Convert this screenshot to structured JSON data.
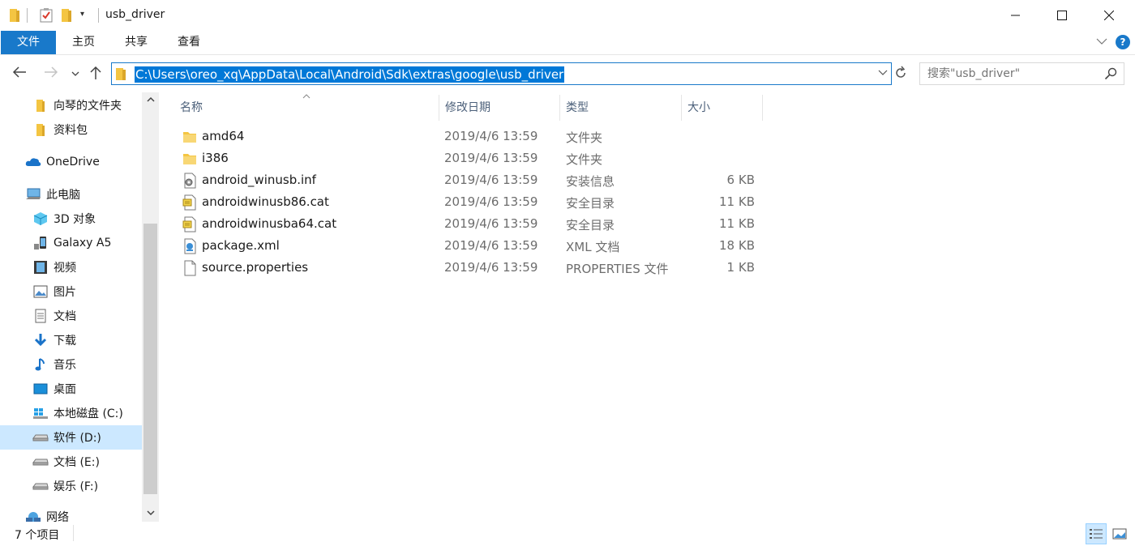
{
  "window": {
    "title": "usb_driver",
    "controls": {
      "minimize": "—",
      "maximize": "☐",
      "close": "✕"
    }
  },
  "ribbon": {
    "tabs": [
      {
        "label": "文件",
        "active": true
      },
      {
        "label": "主页"
      },
      {
        "label": "共享"
      },
      {
        "label": "查看"
      }
    ],
    "help_label": "?"
  },
  "nav": {
    "address": "C:\\Users\\oreo_xq\\AppData\\Local\\Android\\Sdk\\extras\\google\\usb_driver",
    "search_placeholder": "搜索\"usb_driver\""
  },
  "sidebar": {
    "items": [
      {
        "label": "向琴的文件夹",
        "icon": "folder-icon"
      },
      {
        "label": "资料包",
        "icon": "folder-icon"
      },
      {
        "label": "OneDrive",
        "icon": "onedrive-icon"
      },
      {
        "label": "此电脑",
        "icon": "this-pc-icon"
      },
      {
        "label": "3D 对象",
        "icon": "3d-objects-icon"
      },
      {
        "label": "Galaxy A5",
        "icon": "phone-icon"
      },
      {
        "label": "视频",
        "icon": "video-icon"
      },
      {
        "label": "图片",
        "icon": "pictures-icon"
      },
      {
        "label": "文档",
        "icon": "documents-icon"
      },
      {
        "label": "下载",
        "icon": "download-icon"
      },
      {
        "label": "音乐",
        "icon": "music-icon"
      },
      {
        "label": "桌面",
        "icon": "desktop-icon"
      },
      {
        "label": "本地磁盘 (C:)",
        "icon": "windows-drive-icon"
      },
      {
        "label": "软件 (D:)",
        "icon": "drive-icon",
        "selected": true
      },
      {
        "label": "文档 (E:)",
        "icon": "drive-icon"
      },
      {
        "label": "娱乐 (F:)",
        "icon": "drive-icon"
      },
      {
        "label": "网络",
        "icon": "network-icon"
      }
    ]
  },
  "columns": {
    "name": "名称",
    "date": "修改日期",
    "type": "类型",
    "size": "大小"
  },
  "files": [
    {
      "name": "amd64",
      "date": "2019/4/6 13:59",
      "type": "文件夹",
      "size": "",
      "icon": "folder-icon"
    },
    {
      "name": "i386",
      "date": "2019/4/6 13:59",
      "type": "文件夹",
      "size": "",
      "icon": "folder-icon"
    },
    {
      "name": "android_winusb.inf",
      "date": "2019/4/6 13:59",
      "type": "安装信息",
      "size": "6 KB",
      "icon": "setup-info-icon"
    },
    {
      "name": "androidwinusb86.cat",
      "date": "2019/4/6 13:59",
      "type": "安全目录",
      "size": "11 KB",
      "icon": "security-catalog-icon"
    },
    {
      "name": "androidwinusba64.cat",
      "date": "2019/4/6 13:59",
      "type": "安全目录",
      "size": "11 KB",
      "icon": "security-catalog-icon"
    },
    {
      "name": "package.xml",
      "date": "2019/4/6 13:59",
      "type": "XML 文档",
      "size": "18 KB",
      "icon": "xml-file-icon"
    },
    {
      "name": "source.properties",
      "date": "2019/4/6 13:59",
      "type": "PROPERTIES 文件",
      "size": "1 KB",
      "icon": "file-icon"
    }
  ],
  "status": {
    "item_count": "7 个项目"
  },
  "colors": {
    "accent": "#1979ca",
    "selection": "#cce8ff",
    "address_highlight": "#0078d7",
    "folder": "#f4c542"
  }
}
